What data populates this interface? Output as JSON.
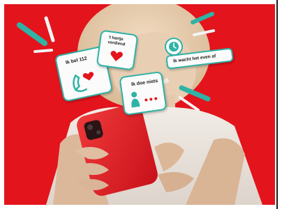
{
  "photo": {
    "description_icon": "person-holding-red-phone-image"
  },
  "cards": {
    "card1": {
      "text": "Ik bel 112",
      "icon": "phone-heart-icon"
    },
    "card2": {
      "text": "'t hartje verdiend",
      "icon": "heart-icon"
    },
    "card3": {
      "text": "Ik doe niets",
      "icon": "person-dots-icon"
    },
    "card4": {
      "text": "Ik wacht het even af",
      "icon": "clock-icon"
    }
  },
  "colors": {
    "background_red": "#e3141c",
    "accent_teal": "#2fb3a6",
    "card_white": "#fbfbfb",
    "heart_red": "#e3141c"
  }
}
